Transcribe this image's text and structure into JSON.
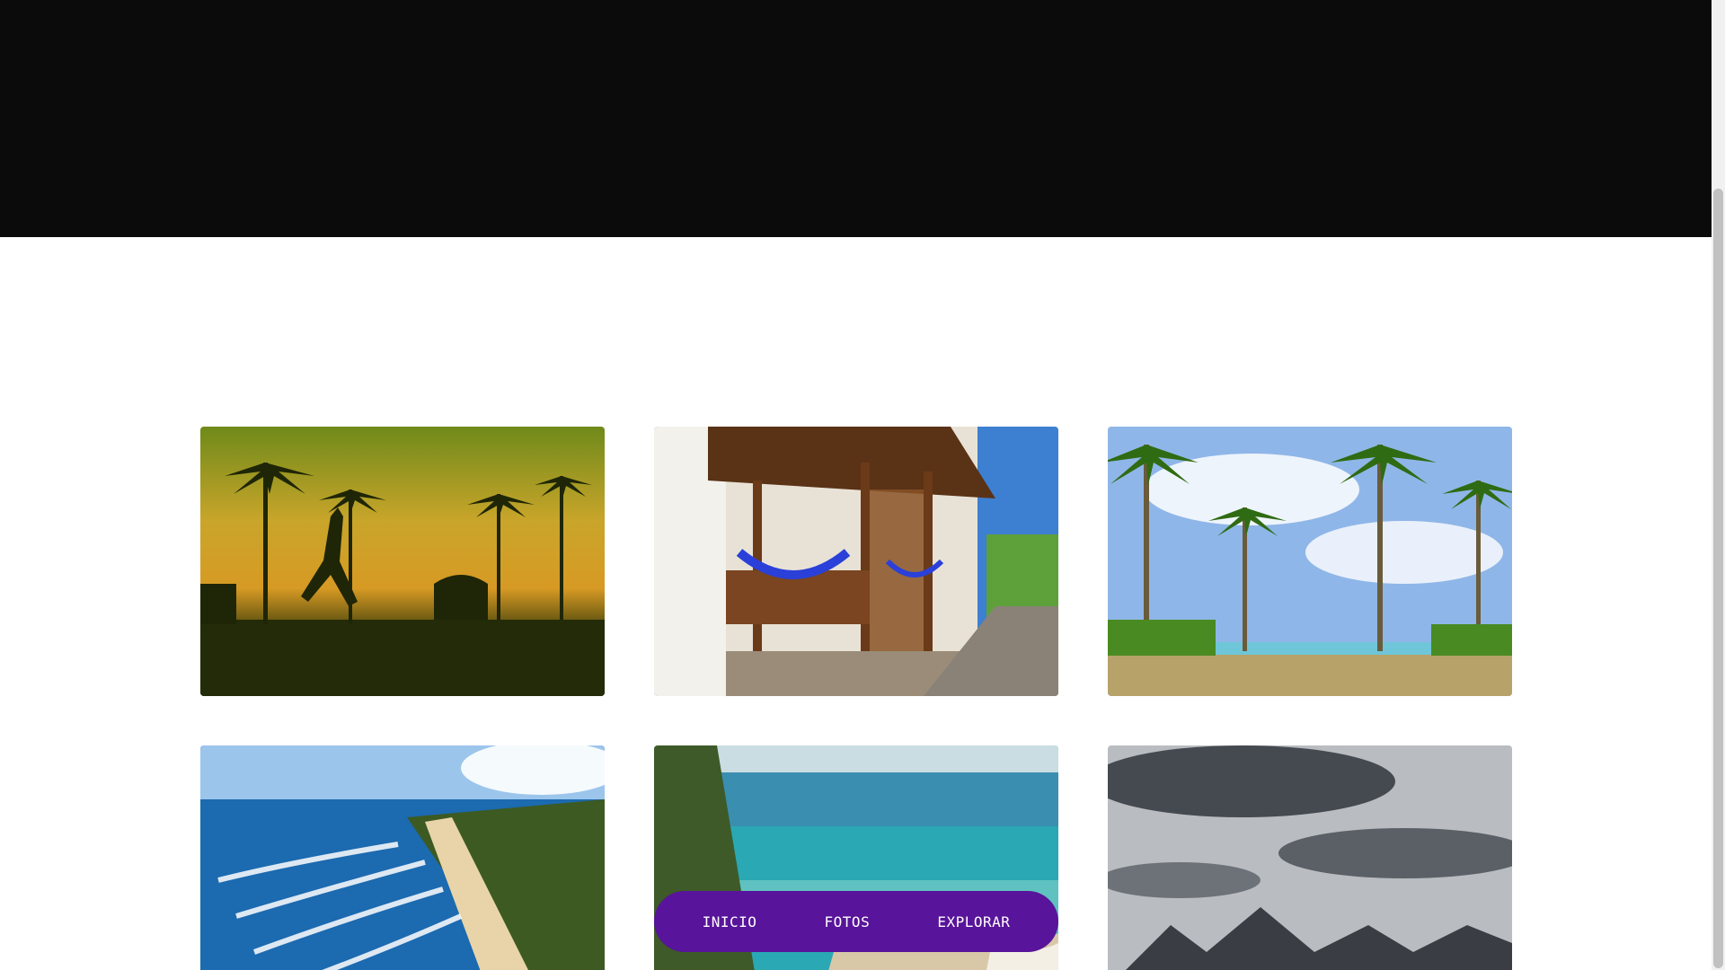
{
  "nav": {
    "items": [
      {
        "label": "INICIO"
      },
      {
        "label": "FOTOS"
      },
      {
        "label": "EXPLORAR"
      }
    ],
    "background_color": "#58149a",
    "text_color": "#ffffff"
  },
  "hero": {
    "background_color": "#0b0b0b"
  },
  "gallery": {
    "photos": [
      {
        "subject": "sunset-palm-silhouettes"
      },
      {
        "subject": "wooden-balcony-hammocks"
      },
      {
        "subject": "palm-grove-beach"
      },
      {
        "subject": "aerial-surf-beach"
      },
      {
        "subject": "turquoise-sea-cliff"
      },
      {
        "subject": "stormy-mountain-lake"
      }
    ]
  }
}
